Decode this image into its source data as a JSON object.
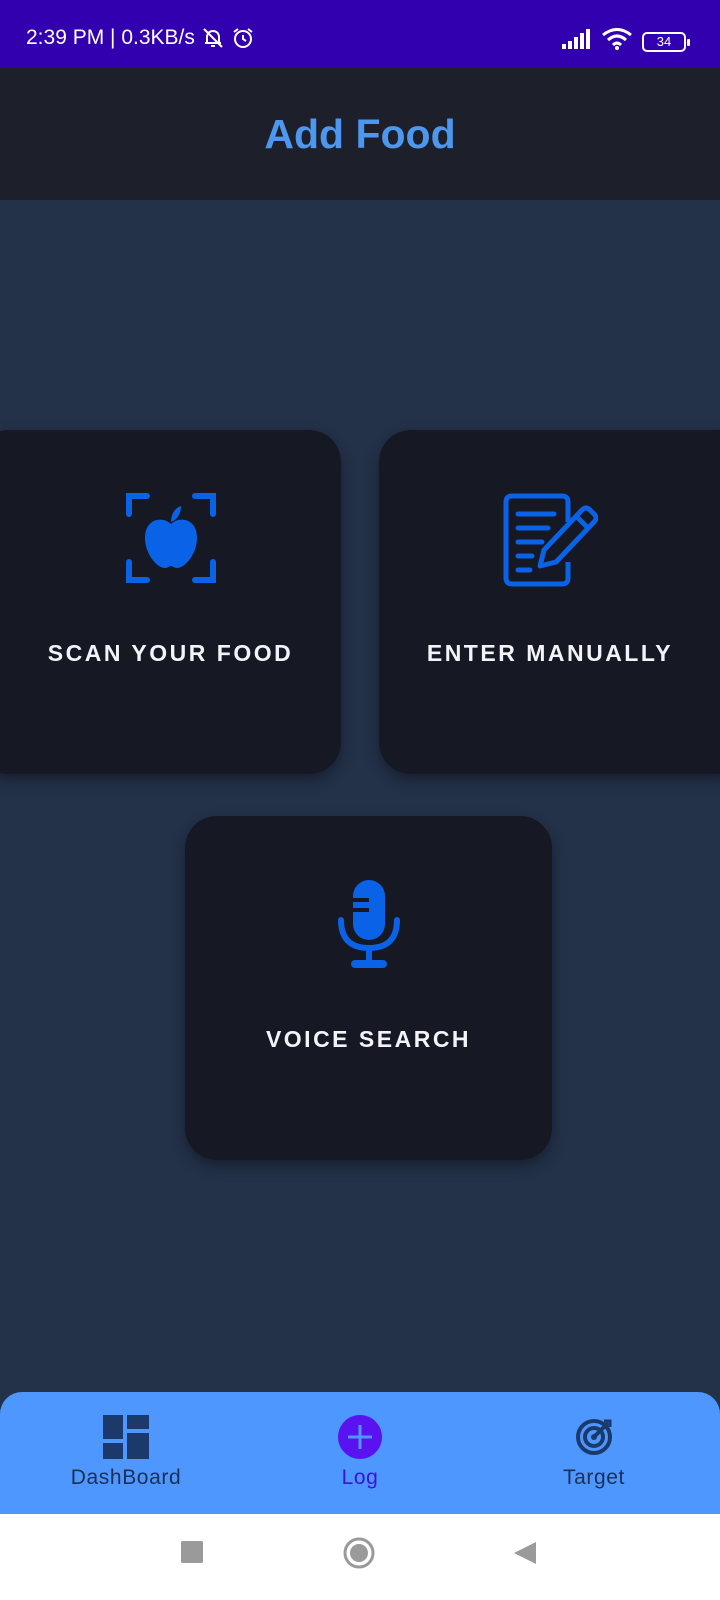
{
  "status_bar": {
    "time_speed": "2:39 PM | 0.3KB/s",
    "battery": "34",
    "icons": [
      "bell-off-icon",
      "alarm-icon",
      "signal-icon",
      "wifi-icon",
      "battery-icon"
    ]
  },
  "app_bar": {
    "title": "Add Food"
  },
  "cards": {
    "scan": {
      "label": "SCAN YOUR FOOD",
      "icon": "scan-apple-icon"
    },
    "manual": {
      "label": "ENTER MANUALLY",
      "icon": "edit-document-icon"
    },
    "voice": {
      "label": "VOICE SEARCH",
      "icon": "microphone-icon"
    }
  },
  "bottom_nav": {
    "items": [
      {
        "label": "DashBoard",
        "icon": "dashboard-icon",
        "active": false
      },
      {
        "label": "Log",
        "icon": "add-circle-icon",
        "active": true
      },
      {
        "label": "Target",
        "icon": "target-icon",
        "active": false
      }
    ]
  },
  "colors": {
    "status_bar": "#3300b0",
    "app_bar": "#1d202b",
    "background": "#233149",
    "card": "#161824",
    "accent_blue": "#0a62e6",
    "title_blue": "#4d97ef",
    "bottom_nav": "#4d97ff",
    "active_purple": "#5a13f0"
  }
}
